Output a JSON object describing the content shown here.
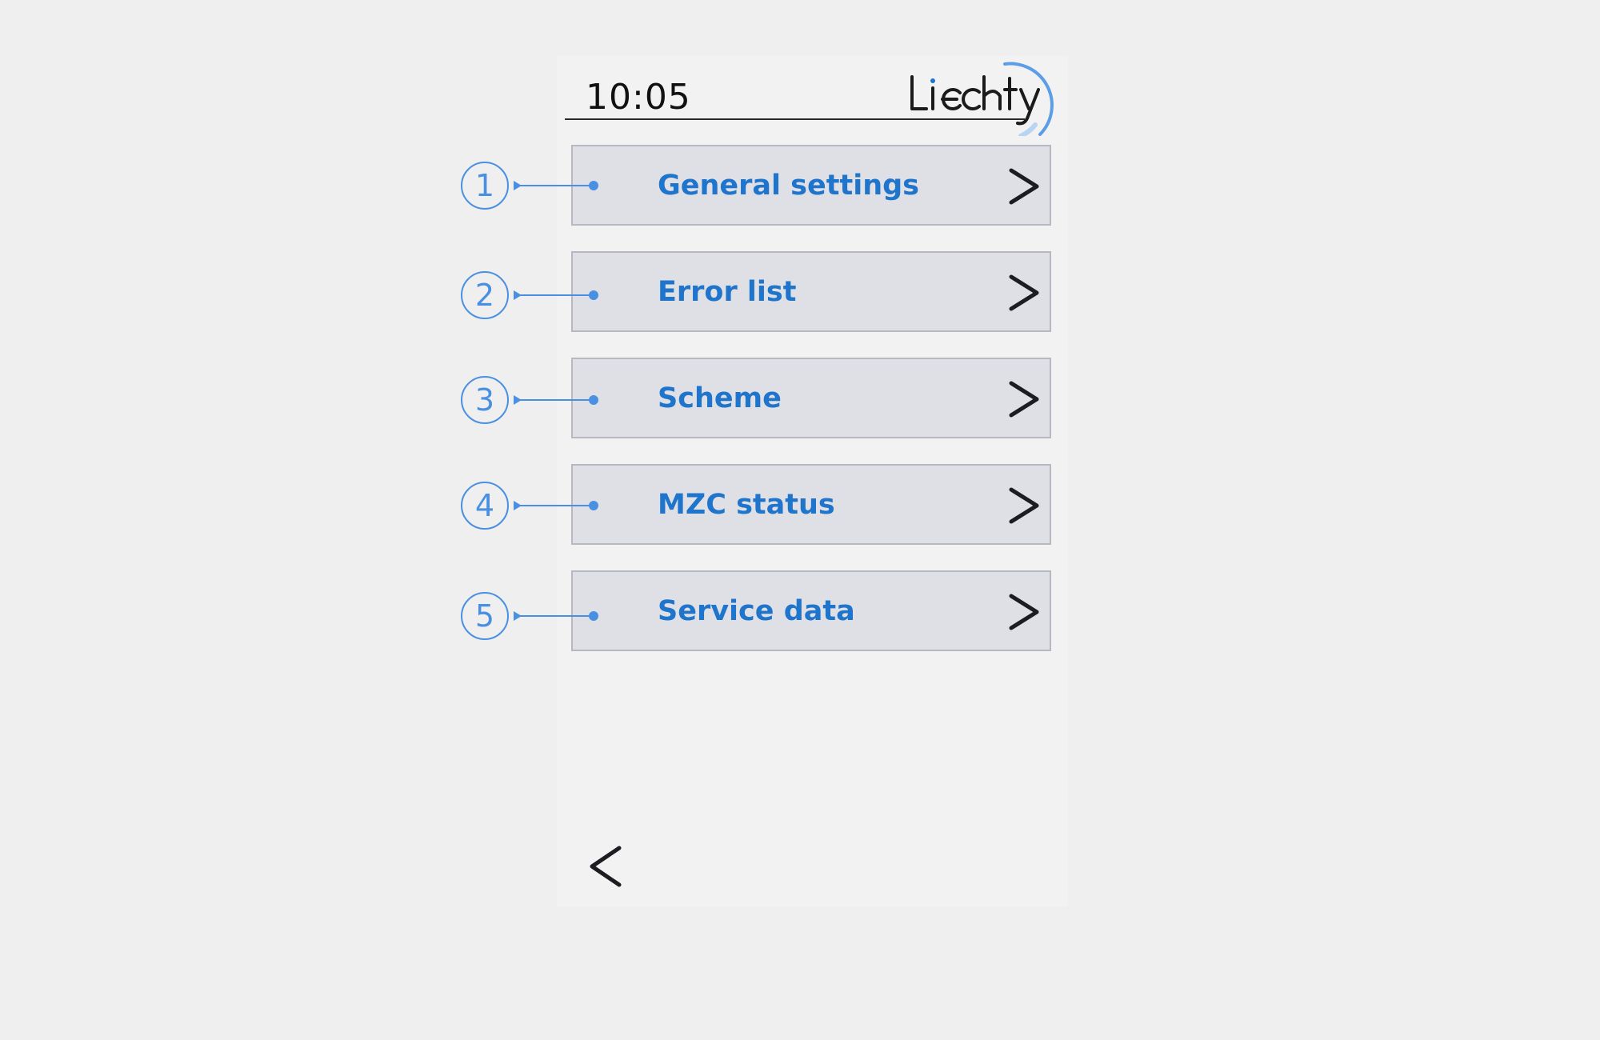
{
  "header": {
    "time": "10:05",
    "brand": "Liechty"
  },
  "menu": {
    "items": [
      {
        "label": "General settings",
        "callout": "1"
      },
      {
        "label": "Error list",
        "callout": "2"
      },
      {
        "label": "Scheme",
        "callout": "3"
      },
      {
        "label": "MZC status",
        "callout": "4"
      },
      {
        "label": "Service data",
        "callout": "5"
      }
    ]
  },
  "icons": {
    "menu_arrow": "chevron-right-icon",
    "back": "chevron-left-icon"
  },
  "colors": {
    "label_blue": "#1f74cc",
    "callout_blue": "#4a90e2",
    "item_background": "#dfe0e5",
    "screen_background": "#f2f2f3"
  }
}
